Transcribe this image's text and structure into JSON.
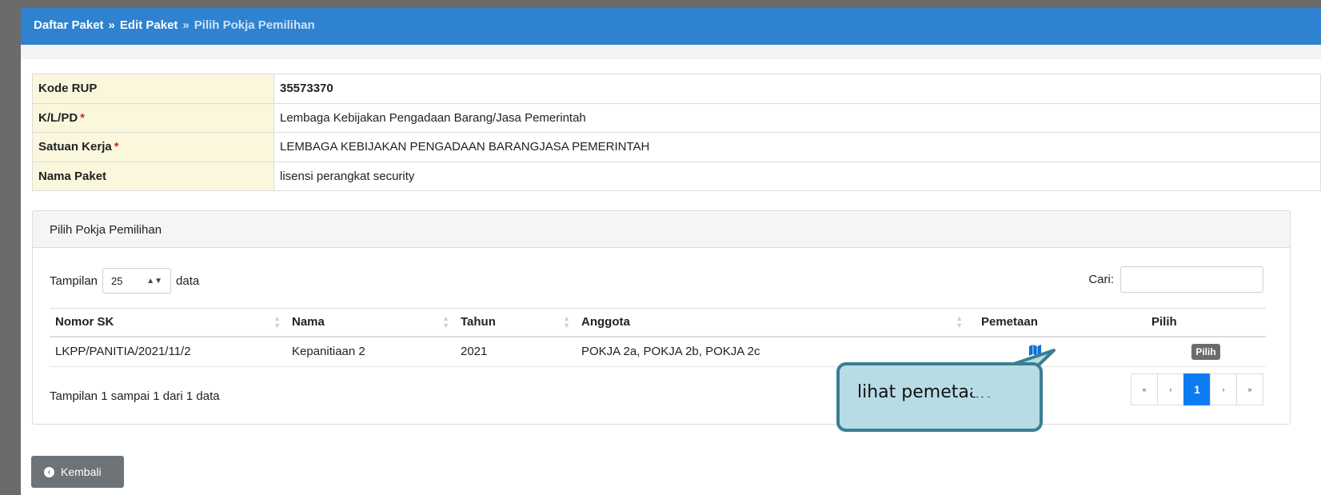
{
  "breadcrumb": {
    "items": [
      "Daftar Paket",
      "Edit Paket"
    ],
    "separator": "»",
    "current": "Pilih Pokja Pemilihan"
  },
  "info": {
    "rows": [
      {
        "label": "Kode RUP",
        "required": "",
        "value": "35573370"
      },
      {
        "label": "K/L/PD",
        "required": "*",
        "value": "Lembaga Kebijakan Pengadaan Barang/Jasa Pemerintah"
      },
      {
        "label": "Satuan Kerja",
        "required": "*",
        "value": "LEMBAGA KEBIJAKAN PENGADAAN BARANGJASA PEMERINTAH"
      },
      {
        "label": "Nama Paket",
        "required": "",
        "value": "lisensi perangkat security"
      }
    ]
  },
  "panel": {
    "title": "Pilih Pokja Pemilihan",
    "length_prefix": "Tampilan",
    "length_value": "25",
    "length_suffix": "data",
    "search_label": "Cari:",
    "search_value": "",
    "columns": [
      "Nomor SK",
      "Nama",
      "Tahun",
      "Anggota",
      "Pemetaan",
      "Pilih"
    ],
    "rows": [
      {
        "nomor_sk": "LKPP/PANITIA/2021/11/2",
        "nama": "Kepanitiaan 2",
        "tahun": "2021",
        "anggota": "POKJA 2a, POKJA 2b, POKJA 2c",
        "pemetaan_icon": "map-icon",
        "pilih_label": "Pilih"
      }
    ],
    "info_text": "Tampilan 1 sampai 1 dari 1 data",
    "pager": {
      "first": "«",
      "prev": "‹",
      "current": "1",
      "next": "›",
      "last": "»"
    }
  },
  "back_button": {
    "label": "Kembali"
  },
  "callout": {
    "text": "lihat pemetaan"
  },
  "colors": {
    "header": "#2e82cf",
    "label_bg": "#fbf7dd",
    "callout_fill": "#b8dce6",
    "callout_border": "#3b7e92",
    "pager_active": "#0d7cf2"
  }
}
